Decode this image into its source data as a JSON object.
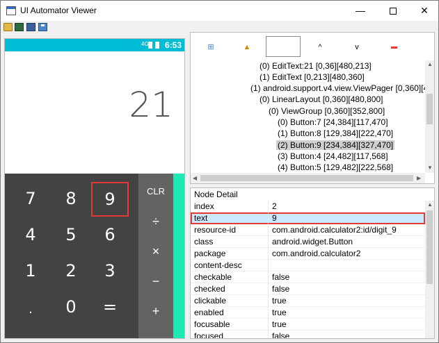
{
  "window": {
    "title": "UI Automator Viewer",
    "min_label": "—",
    "close_label": "✕"
  },
  "toolbar": {
    "icons": [
      "open-folder-icon",
      "device-screenshot-icon",
      "device-screenshot-compressed-icon",
      "save-icon"
    ]
  },
  "device": {
    "status": {
      "signal": "4G",
      "time": "6:53"
    },
    "display_value": "21",
    "keys": [
      {
        "label": "7"
      },
      {
        "label": "8"
      },
      {
        "label": "9"
      },
      {
        "label": "4"
      },
      {
        "label": "5"
      },
      {
        "label": "6"
      },
      {
        "label": "1"
      },
      {
        "label": "2"
      },
      {
        "label": "3"
      },
      {
        "label": "."
      },
      {
        "label": "0"
      },
      {
        "label": "="
      }
    ],
    "ops": [
      {
        "label": "CLR"
      },
      {
        "label": "÷"
      },
      {
        "label": "×"
      },
      {
        "label": "−"
      },
      {
        "label": "+"
      }
    ],
    "colors": {
      "status_bar": "#00bcd4",
      "keypad": "#434343",
      "ops_pad": "#636363",
      "accent": "#1de9b6",
      "selection": "#e53935"
    }
  },
  "hierarchy": {
    "toolbar": {
      "expand_icon": "⊞",
      "warn_icon": "▲",
      "up_icon": "^",
      "down_icon": "v"
    },
    "rows": [
      {
        "text": "(0) EditText:21 [0,36][480,213]",
        "indent": 1,
        "selected": false
      },
      {
        "text": "(1) EditText [0,213][480,360]",
        "indent": 1,
        "selected": false
      },
      {
        "text": "(1) android.support.v4.view.ViewPager [0,360][4",
        "indent": 0,
        "selected": false
      },
      {
        "text": "(0) LinearLayout [0,360][480,800]",
        "indent": 1,
        "selected": false
      },
      {
        "text": "(0) ViewGroup [0,360][352,800]",
        "indent": 2,
        "selected": false
      },
      {
        "text": "(0) Button:7 [24,384][117,470]",
        "indent": 3,
        "selected": false
      },
      {
        "text": "(1) Button:8 [129,384][222,470]",
        "indent": 3,
        "selected": false
      },
      {
        "text": "(2) Button:9 [234,384][327,470]",
        "indent": 3,
        "selected": true
      },
      {
        "text": "(3) Button:4 [24,482][117,568]",
        "indent": 3,
        "selected": false
      },
      {
        "text": "(4) Button:5 [129,482][222,568]",
        "indent": 3,
        "selected": false
      }
    ]
  },
  "node_detail": {
    "header": "Node Detail",
    "rows": [
      {
        "key": "index",
        "value": "2"
      },
      {
        "key": "text",
        "value": "9"
      },
      {
        "key": "resource-id",
        "value": "com.android.calculator2:id/digit_9"
      },
      {
        "key": "class",
        "value": "android.widget.Button"
      },
      {
        "key": "package",
        "value": "com.android.calculator2"
      },
      {
        "key": "content-desc",
        "value": ""
      },
      {
        "key": "checkable",
        "value": "false"
      },
      {
        "key": "checked",
        "value": "false"
      },
      {
        "key": "clickable",
        "value": "true"
      },
      {
        "key": "enabled",
        "value": "true"
      },
      {
        "key": "focusable",
        "value": "true"
      },
      {
        "key": "focused",
        "value": "false"
      }
    ]
  }
}
